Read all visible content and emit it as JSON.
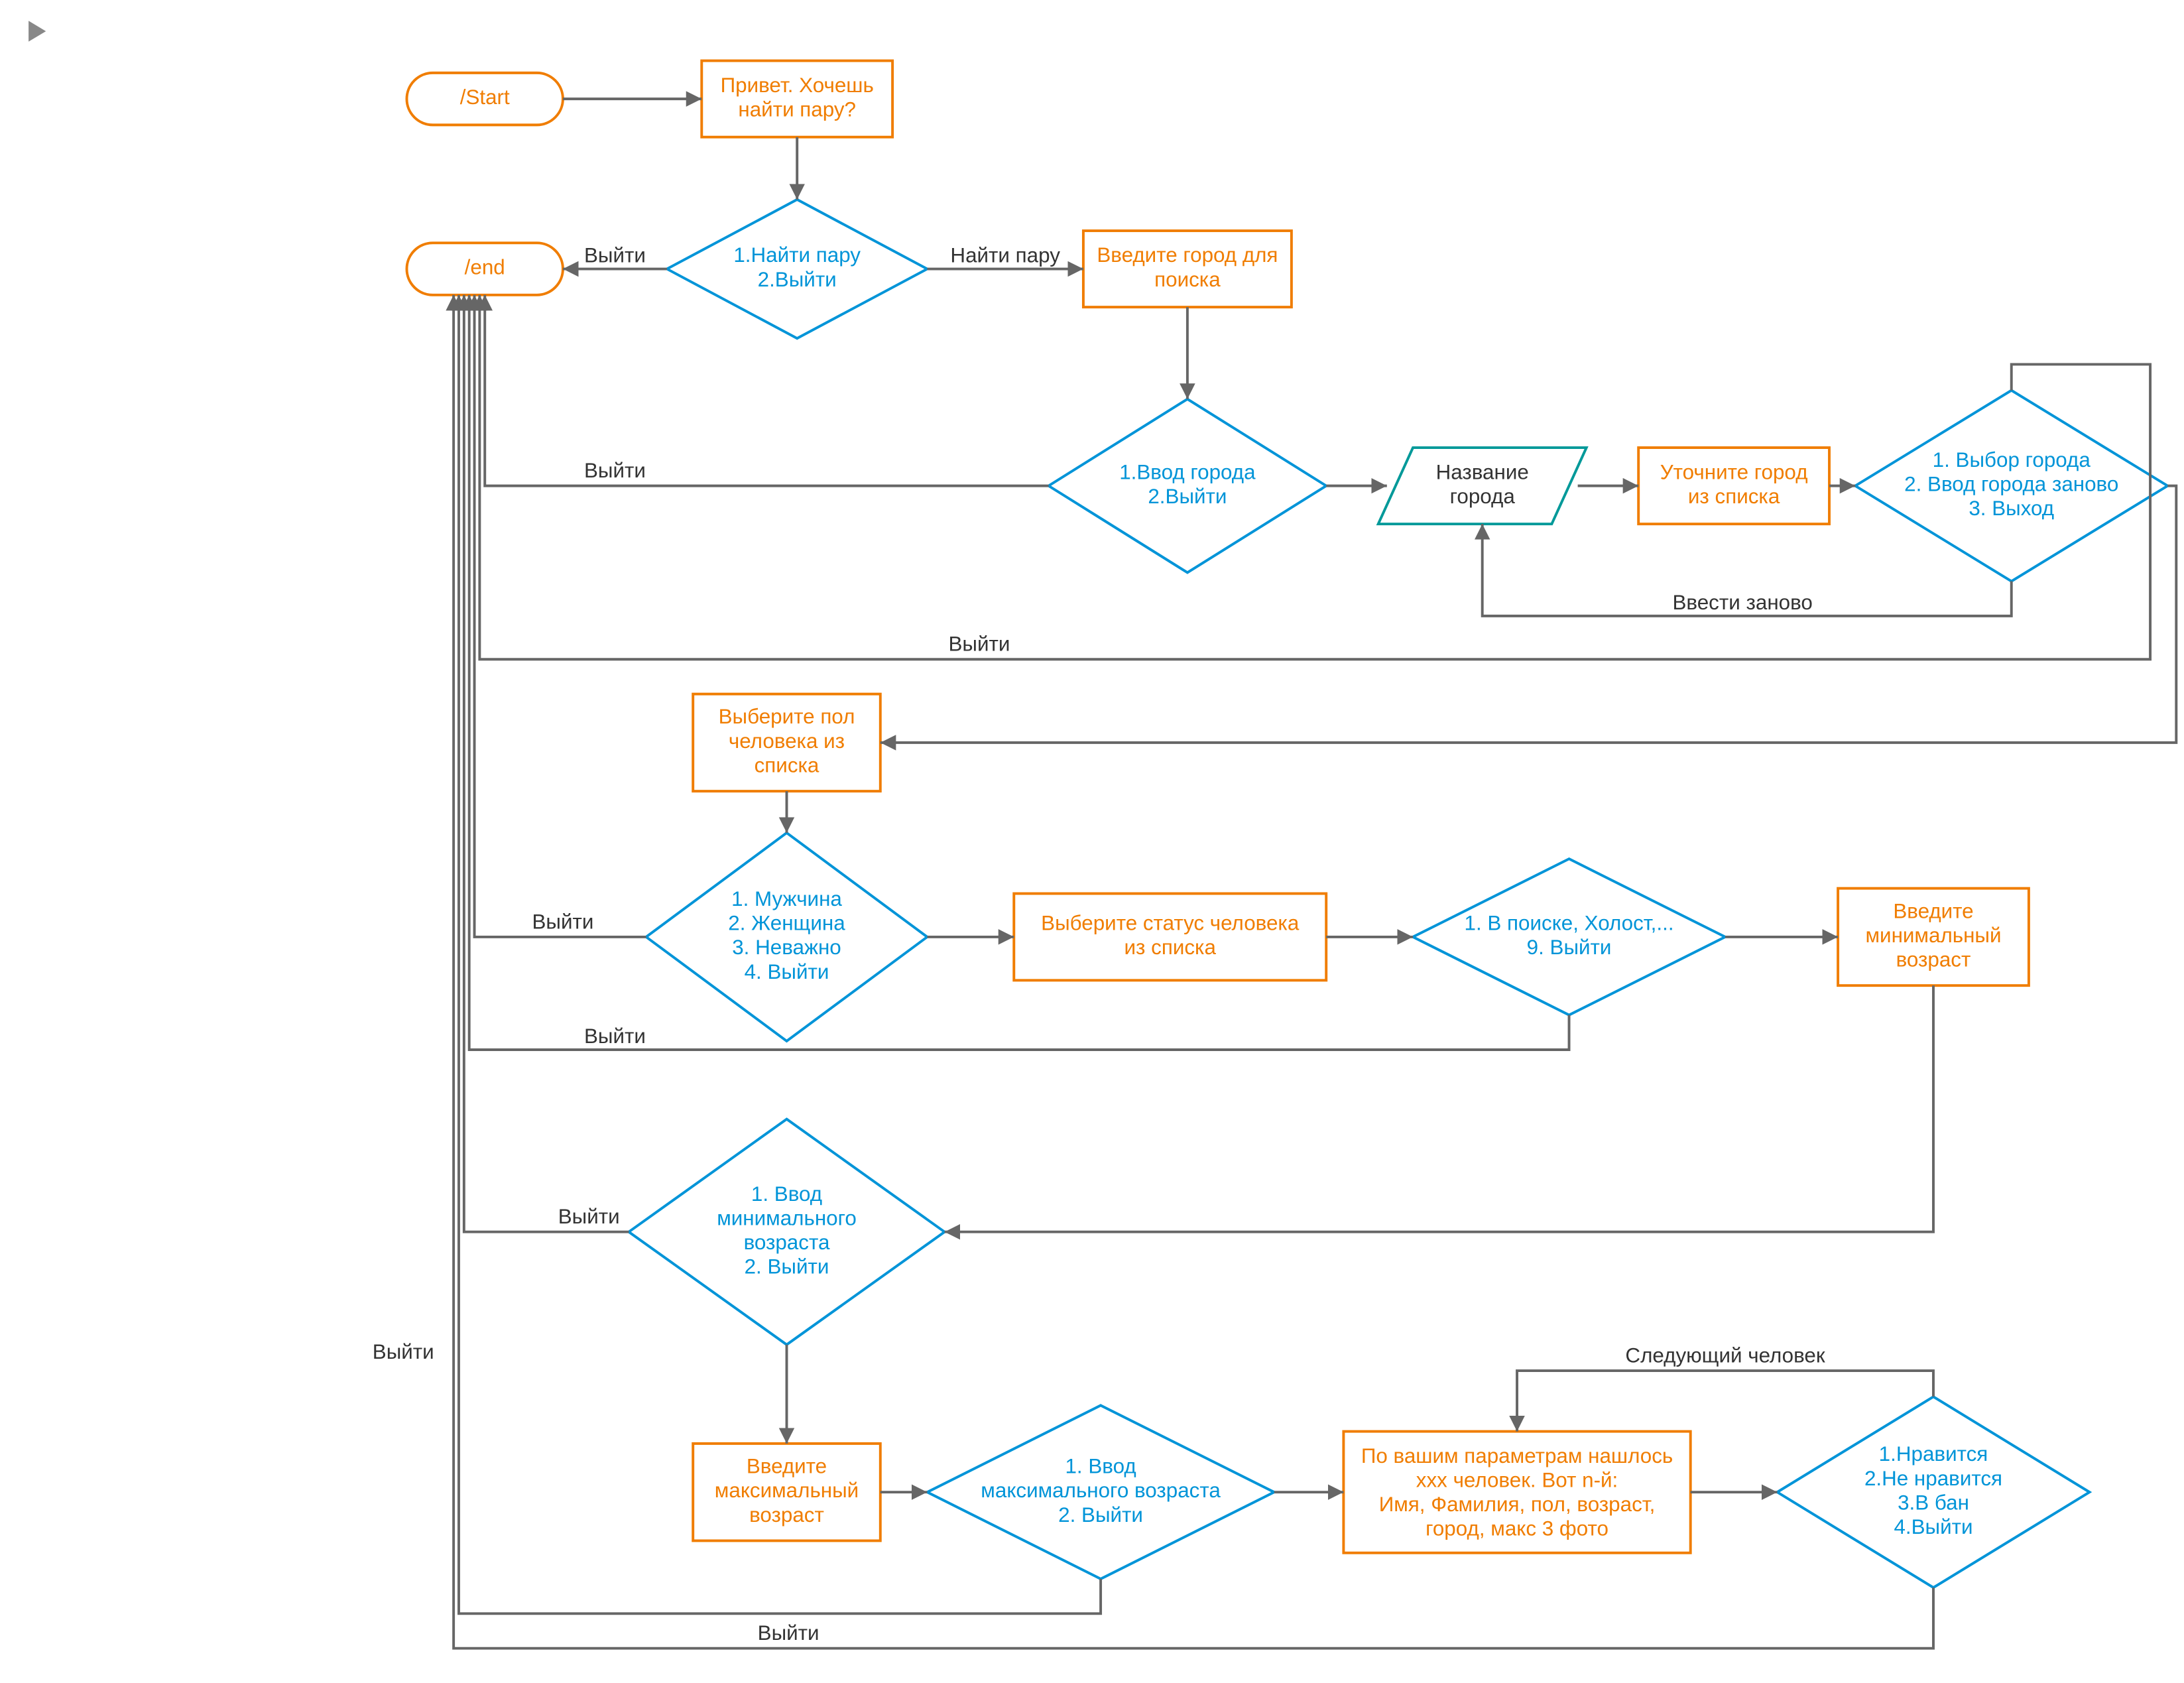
{
  "chart_data": {
    "type": "flowchart",
    "nodes": [
      {
        "id": "start",
        "shape": "terminator",
        "color": "orange",
        "text": "/Start"
      },
      {
        "id": "greet",
        "shape": "process",
        "color": "orange",
        "text": "Привет. Хочешь найти пару?"
      },
      {
        "id": "d_find",
        "shape": "decision",
        "color": "blue",
        "text": "1.Найти пару 2.Выйти"
      },
      {
        "id": "end",
        "shape": "terminator",
        "color": "orange",
        "text": "/end"
      },
      {
        "id": "city_in",
        "shape": "process",
        "color": "orange",
        "text": "Введите город для поиска"
      },
      {
        "id": "d_city",
        "shape": "decision",
        "color": "blue",
        "text": "1.Ввод города 2.Выйти"
      },
      {
        "id": "city_nm",
        "shape": "data",
        "color": "teal",
        "text": "Название города"
      },
      {
        "id": "city_cl",
        "shape": "process",
        "color": "orange",
        "text": "Уточните город из списка"
      },
      {
        "id": "d_city2",
        "shape": "decision",
        "color": "blue",
        "text": "1. Выбор города 2. Ввод города заново 3. Выход"
      },
      {
        "id": "sex",
        "shape": "process",
        "color": "orange",
        "text": "Выберите пол человека из списка"
      },
      {
        "id": "d_sex",
        "shape": "decision",
        "color": "blue",
        "text": "1. Мужчина 2. Женщина 3. Неважно 4. Выйти"
      },
      {
        "id": "status",
        "shape": "process",
        "color": "orange",
        "text": "Выберите статус человека из списка"
      },
      {
        "id": "d_stat",
        "shape": "decision",
        "color": "blue",
        "text": "1. В поиске, Холост,... 9. Выйти"
      },
      {
        "id": "minage",
        "shape": "process",
        "color": "orange",
        "text": "Введите минимальный возраст"
      },
      {
        "id": "d_min",
        "shape": "decision",
        "color": "blue",
        "text": "1. Ввод минимального возраста 2. Выйти"
      },
      {
        "id": "maxage",
        "shape": "process",
        "color": "orange",
        "text": "Введите максимальный возраст"
      },
      {
        "id": "d_max",
        "shape": "decision",
        "color": "blue",
        "text": "1. Ввод максимального возраста 2. Выйти"
      },
      {
        "id": "result",
        "shape": "process",
        "color": "orange",
        "text": "По вашим параметрам нашлось ххх человек. Вот n-й: Имя, Фамилия, пол, возраст, город, макс 3 фото"
      },
      {
        "id": "d_like",
        "shape": "decision",
        "color": "blue",
        "text": "1.Нравится 2.Не нравится 3.В бан 4.Выйти"
      }
    ],
    "edges": [
      {
        "from": "start",
        "to": "greet"
      },
      {
        "from": "greet",
        "to": "d_find"
      },
      {
        "from": "d_find",
        "to": "end",
        "label": "Выйти"
      },
      {
        "from": "d_find",
        "to": "city_in",
        "label": "Найти пару"
      },
      {
        "from": "city_in",
        "to": "d_city"
      },
      {
        "from": "d_city",
        "to": "end",
        "label": "Выйти"
      },
      {
        "from": "d_city",
        "to": "city_nm"
      },
      {
        "from": "city_nm",
        "to": "city_cl"
      },
      {
        "from": "city_cl",
        "to": "d_city2"
      },
      {
        "from": "d_city2",
        "to": "city_nm",
        "label": "Ввести заново"
      },
      {
        "from": "d_city2",
        "to": "end",
        "label": "Выйти"
      },
      {
        "from": "d_city2",
        "to": "sex"
      },
      {
        "from": "sex",
        "to": "d_sex"
      },
      {
        "from": "d_sex",
        "to": "end",
        "label": "Выйти"
      },
      {
        "from": "d_sex",
        "to": "status"
      },
      {
        "from": "status",
        "to": "d_stat"
      },
      {
        "from": "d_stat",
        "to": "end",
        "label": "Выйти"
      },
      {
        "from": "d_stat",
        "to": "minage"
      },
      {
        "from": "minage",
        "to": "d_min"
      },
      {
        "from": "d_min",
        "to": "end",
        "label": "Выйти"
      },
      {
        "from": "d_min",
        "to": "maxage"
      },
      {
        "from": "maxage",
        "to": "d_max"
      },
      {
        "from": "d_max",
        "to": "end",
        "label": "Выйти"
      },
      {
        "from": "d_max",
        "to": "result"
      },
      {
        "from": "result",
        "to": "d_like"
      },
      {
        "from": "d_like",
        "to": "result",
        "label": "Следующий человек"
      },
      {
        "from": "d_like",
        "to": "end",
        "label": "Выйти"
      }
    ]
  },
  "nodes": {
    "start": {
      "l1": "/Start"
    },
    "greet": {
      "l1": "Привет. Хочешь",
      "l2": "найти пару?"
    },
    "d_find": {
      "l1": "1.Найти пару",
      "l2": "2.Выйти"
    },
    "end": {
      "l1": "/end"
    },
    "city_in": {
      "l1": "Введите город для",
      "l2": "поиска"
    },
    "d_city": {
      "l1": "1.Ввод города",
      "l2": "2.Выйти"
    },
    "city_nm": {
      "l1": "Название",
      "l2": "города"
    },
    "city_cl": {
      "l1": "Уточните город",
      "l2": "из списка"
    },
    "d_city2": {
      "l1": "1. Выбор города",
      "l2": "2. Ввод города заново",
      "l3": "3. Выход"
    },
    "sex": {
      "l1": "Выберите пол",
      "l2": "человека из",
      "l3": "списка"
    },
    "d_sex": {
      "l1": "1. Мужчина",
      "l2": "2. Женщина",
      "l3": "3. Неважно",
      "l4": "4. Выйти"
    },
    "status": {
      "l1": "Выберите статус человека",
      "l2": "из списка"
    },
    "d_stat": {
      "l1": "1. В поиске, Холост,...",
      "l2": "9. Выйти"
    },
    "minage": {
      "l1": "Введите",
      "l2": "минимальный",
      "l3": "возраст"
    },
    "d_min": {
      "l1": "1. Ввод",
      "l2": "минимального",
      "l3": "возраста",
      "l4": "2. Выйти"
    },
    "maxage": {
      "l1": "Введите",
      "l2": "максимальный",
      "l3": "возраст"
    },
    "d_max": {
      "l1": "1. Ввод",
      "l2": "максимального возраста",
      "l3": "2. Выйти"
    },
    "result": {
      "l1": "По вашим параметрам нашлось",
      "l2": "ххх человек. Вот n-й:",
      "l3": "Имя, Фамилия, пол, возраст,",
      "l4": "город, макс 3 фото"
    },
    "d_like": {
      "l1": "1.Нравится",
      "l2": "2.Не нравится",
      "l3": "3.В бан",
      "l4": "4.Выйти"
    }
  },
  "labels": {
    "exit": "Выйти",
    "find": "Найти пару",
    "reenter": "Ввести заново",
    "next": "Следующий человек"
  }
}
